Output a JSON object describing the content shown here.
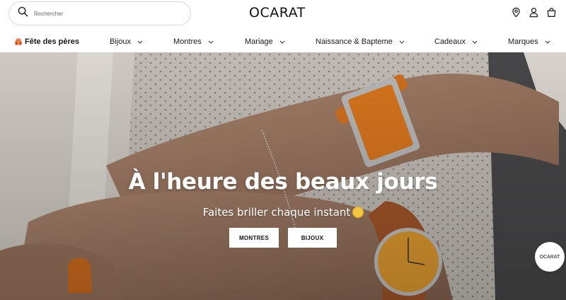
{
  "header": {
    "search_placeholder": "Rechercher",
    "logo": "OCARAT",
    "icons": [
      "search-icon",
      "location-pin-icon",
      "user-icon",
      "shopping-bag-icon"
    ]
  },
  "nav": {
    "items": [
      {
        "label": "Fête des pères",
        "icon": "gift-icon",
        "bold": true
      },
      {
        "label": "Bijoux",
        "has_dropdown": true
      },
      {
        "label": "Montres",
        "has_dropdown": true
      },
      {
        "label": "Mariage",
        "has_dropdown": true
      },
      {
        "label": "Naissance & Bapteme",
        "has_dropdown": true
      },
      {
        "label": "Cadeaux",
        "has_dropdown": true
      },
      {
        "label": "Marques",
        "has_dropdown": true
      }
    ]
  },
  "hero": {
    "title": "À l'heure des beaux jours",
    "subtitle": "Faites briller chaque instant",
    "subtitle_emoji": "sun-icon",
    "buttons": [
      "MONTRES",
      "BIJOUX"
    ],
    "badge": "OCARAT"
  },
  "colors": {
    "hero_overlay": "#6e6862",
    "watch_orange": "#e07a1f",
    "button_bg": "#ffffff"
  }
}
